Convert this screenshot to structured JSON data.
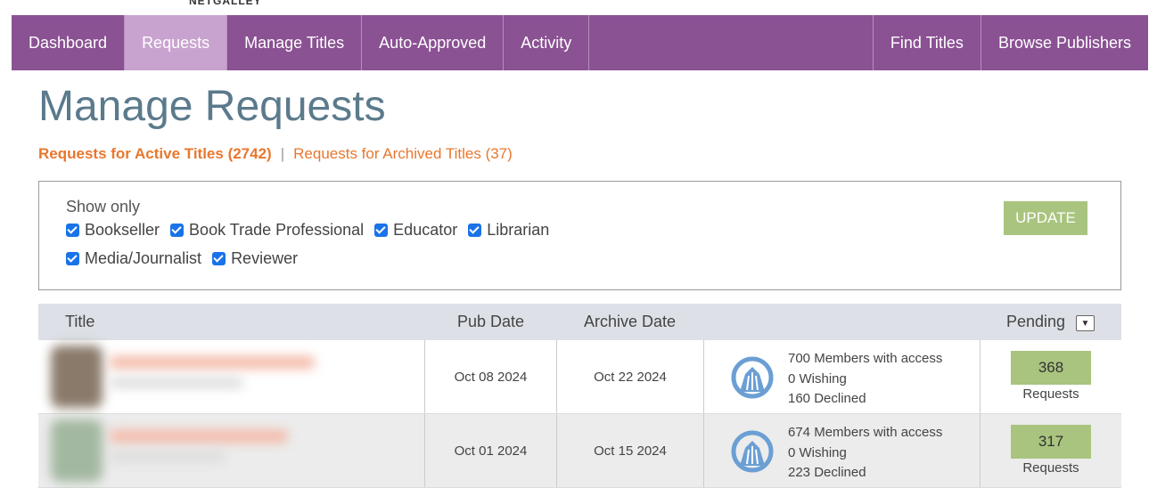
{
  "logo_fragment": "NETGALLEY",
  "nav": {
    "left": [
      {
        "label": "Dashboard",
        "active": false
      },
      {
        "label": "Requests",
        "active": true
      },
      {
        "label": "Manage Titles",
        "active": false
      },
      {
        "label": "Auto-Approved",
        "active": false
      },
      {
        "label": "Activity",
        "active": false
      }
    ],
    "right": [
      {
        "label": "Find Titles"
      },
      {
        "label": "Browse Publishers"
      }
    ]
  },
  "page_title": "Manage Requests",
  "subnav": {
    "active_label": "Requests for Active Titles (2742)",
    "separator": "|",
    "archived_label": "Requests for Archived Titles (37)"
  },
  "filters": {
    "show_only_label": "Show only",
    "options": [
      {
        "label": "Bookseller",
        "checked": true
      },
      {
        "label": "Book Trade Professional",
        "checked": true
      },
      {
        "label": "Educator",
        "checked": true
      },
      {
        "label": "Librarian",
        "checked": true
      },
      {
        "label": "Media/Journalist",
        "checked": true
      },
      {
        "label": "Reviewer",
        "checked": true
      }
    ],
    "update_label": "UPDATE"
  },
  "table": {
    "headers": {
      "title": "Title",
      "pub_date": "Pub Date",
      "archive_date": "Archive Date",
      "pending": "Pending"
    },
    "sort_icon": "caret-down-icon",
    "rows": [
      {
        "pub_date": "Oct 08 2024",
        "archive_date": "Oct 22 2024",
        "members_access": "700 Members with access",
        "wishing": "0 Wishing",
        "declined": "160 Declined",
        "pending_count": "368",
        "pending_label": "Requests"
      },
      {
        "pub_date": "Oct 01 2024",
        "archive_date": "Oct 15 2024",
        "members_access": "674 Members with access",
        "wishing": "0 Wishing",
        "declined": "223 Declined",
        "pending_count": "317",
        "pending_label": "Requests"
      }
    ]
  },
  "colors": {
    "nav_bg": "#8a5193",
    "nav_active": "#c9a3cf",
    "title": "#5b7a8c",
    "link": "#e8772e",
    "button_green": "#a9c47f",
    "gauge_blue": "#6b9fd4"
  }
}
